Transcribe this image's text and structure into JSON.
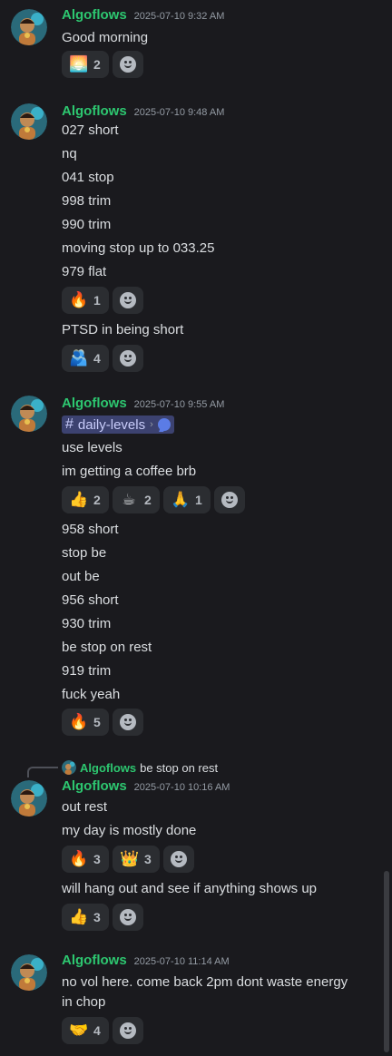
{
  "messages": [
    {
      "username": "Algoflows",
      "timestamp": "2025-07-10 9:32 AM",
      "lines": [
        "Good morning"
      ],
      "reactions": [
        {
          "emoji": "🌅",
          "icon": "sunrise-icon",
          "count": "2"
        }
      ]
    },
    {
      "username": "Algoflows",
      "timestamp": "2025-07-10 9:48 AM",
      "lines": [
        "027 short",
        "nq",
        "041 stop",
        "998 trim",
        "990 trim",
        "moving stop up to 033.25",
        "979 flat"
      ],
      "reactions": [
        {
          "emoji": "🔥",
          "icon": "fire-icon",
          "count": "1"
        }
      ],
      "lines2": [
        "PTSD in being short"
      ],
      "reactions2": [
        {
          "emoji": "🫂",
          "icon": "people-hugging-icon",
          "count": "4"
        }
      ]
    },
    {
      "username": "Algoflows",
      "timestamp": "2025-07-10 9:55 AM",
      "channel_mention": {
        "name": "daily-levels",
        "separator": "›"
      },
      "lines": [
        "use levels",
        "im getting a coffee brb"
      ],
      "reactions": [
        {
          "emoji": "👍",
          "icon": "thumbs-up-icon",
          "count": "2"
        },
        {
          "emoji": "☕",
          "icon": "coffee-icon",
          "count": "2"
        },
        {
          "emoji": "🙏",
          "icon": "folded-hands-icon",
          "count": "1"
        }
      ],
      "lines2": [
        "958 short",
        "stop be",
        "out be",
        "956 short",
        "930 trim",
        "be stop on rest",
        "919 trim",
        "fuck yeah"
      ],
      "reactions2": [
        {
          "emoji": "🔥",
          "icon": "fire-icon",
          "count": "5"
        }
      ]
    },
    {
      "reply_to": {
        "username": "Algoflows",
        "text": "be stop on rest"
      },
      "username": "Algoflows",
      "timestamp": "2025-07-10 10:16 AM",
      "lines": [
        "out rest",
        "my day is mostly done"
      ],
      "reactions": [
        {
          "emoji": "🔥",
          "icon": "fire-icon",
          "count": "3"
        },
        {
          "emoji": "👑",
          "icon": "crown-icon",
          "count": "3"
        }
      ],
      "lines2": [
        "will hang out and see if anything shows up"
      ],
      "reactions2": [
        {
          "emoji": "👍",
          "icon": "thumbs-up-icon",
          "count": "3"
        }
      ]
    },
    {
      "username": "Algoflows",
      "timestamp": "2025-07-10 11:14 AM",
      "lines": [
        "no vol here. come back 2pm dont waste energy in chop"
      ],
      "reactions": [
        {
          "emoji": "🤝",
          "icon": "handshake-icon",
          "count": "4"
        }
      ]
    }
  ],
  "colors": {
    "background": "#1a1a1e",
    "username": "#2dc770",
    "reaction_bg": "#2b2d31",
    "mention_bg": "#3c4270"
  }
}
